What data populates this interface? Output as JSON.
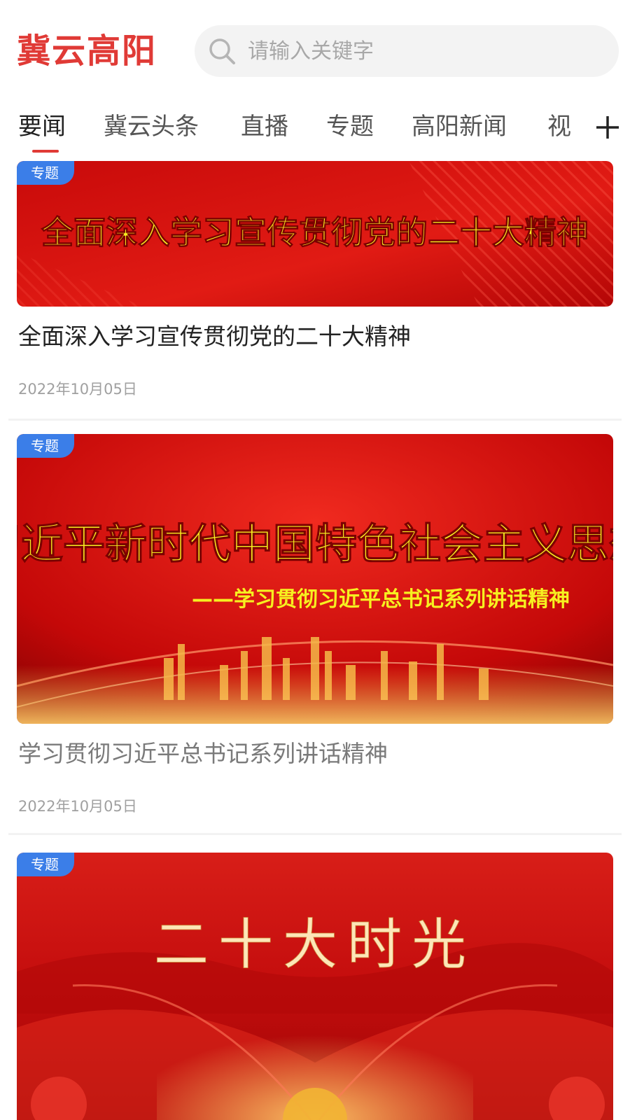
{
  "header": {
    "app_title": "冀云高阳",
    "search_placeholder": "请输入关键字"
  },
  "tabs": [
    {
      "label": "要闻",
      "active": true
    },
    {
      "label": "冀云头条",
      "active": false
    },
    {
      "label": "直播",
      "active": false
    },
    {
      "label": "专题",
      "active": false
    },
    {
      "label": "高阳新闻",
      "active": false
    },
    {
      "label": "视",
      "active": false
    }
  ],
  "icons": {
    "search": "search-icon",
    "add_channel": "plus-icon"
  },
  "colors": {
    "brand_red": "#e03a36",
    "badge_blue": "#3b7ee8",
    "banner_text_yellow": "#f6f020",
    "banner_text_gold": "#fde6b8"
  },
  "articles": [
    {
      "badge": "专题",
      "banner_text": "全面深入学习宣传贯彻党的二十大精神",
      "title": "全面深入学习宣传贯彻党的二十大精神",
      "date": "2022年10月05日"
    },
    {
      "badge": "专题",
      "banner_text": "习近平新时代中国特色社会主义思想",
      "banner_subtext": "——学习贯彻习近平总书记系列讲话精神",
      "title": "学习贯彻习近平总书记系列讲话精神",
      "date": "2022年10月05日"
    },
    {
      "badge": "专题",
      "banner_text": "二十大时光"
    }
  ]
}
